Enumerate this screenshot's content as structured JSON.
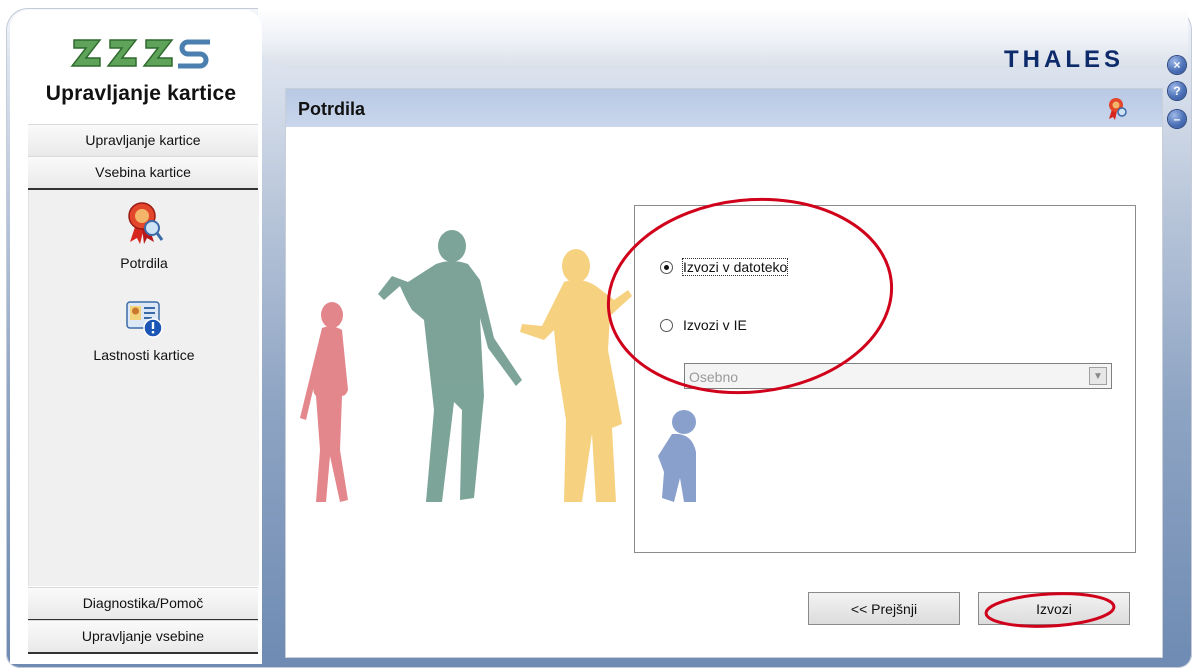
{
  "app": {
    "title": "Upravljanje kartice",
    "brand": "THALES"
  },
  "window_controls": [
    {
      "name": "close",
      "glyph": "×"
    },
    {
      "name": "help",
      "glyph": "?"
    },
    {
      "name": "minimize",
      "glyph": "–"
    }
  ],
  "sidebar": {
    "top_items": [
      {
        "label": "Upravljanje kartice"
      },
      {
        "label": "Vsebina kartice"
      }
    ],
    "icon_items": [
      {
        "label": "Potrdila",
        "icon": "certificate-icon"
      },
      {
        "label": "Lastnosti kartice",
        "icon": "card-properties-icon"
      }
    ],
    "bottom_items": [
      {
        "label": "Diagnostika/Pomoč"
      },
      {
        "label": "Upravljanje vsebine"
      }
    ]
  },
  "content": {
    "title": "Potrdila",
    "options": {
      "export_file": "Izvozi v datoteko",
      "export_ie": "Izvozi v IE",
      "selected": "Izvozi v datoteko"
    },
    "store_select": {
      "value": "Osebno"
    },
    "buttons": {
      "back": "<< Prejšnji",
      "export": "Izvozi"
    }
  },
  "colors": {
    "annotation": "#d0021b",
    "header": "#c3d2ea",
    "silhouette_red": "#e07a80",
    "silhouette_green": "#6f9a8e",
    "silhouette_yellow": "#f5c96a",
    "silhouette_blue": "#7d96c8"
  }
}
